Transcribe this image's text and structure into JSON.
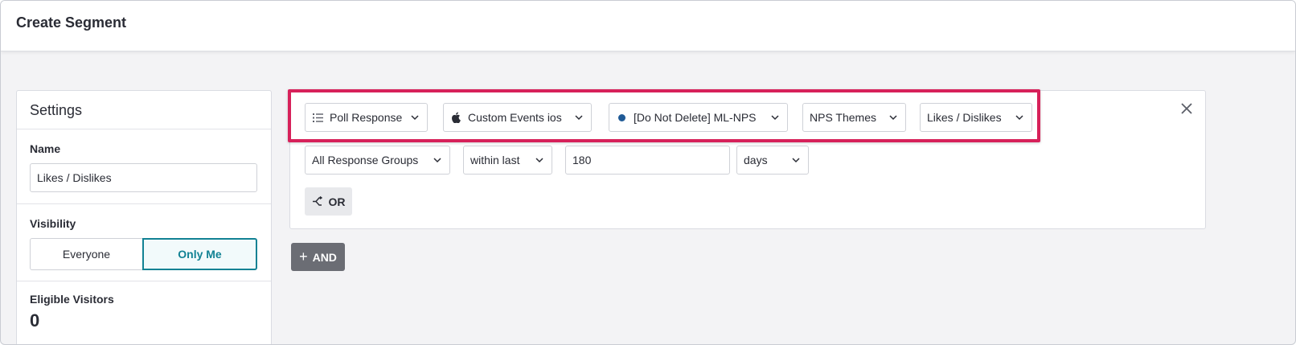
{
  "header": {
    "title": "Create Segment"
  },
  "settings": {
    "title": "Settings",
    "name_label": "Name",
    "name_value": "Likes / Dislikes",
    "visibility_label": "Visibility",
    "visibility_options": [
      "Everyone",
      "Only Me"
    ],
    "visibility_selected": "Only Me",
    "eligible_label": "Eligible Visitors",
    "eligible_count": "0"
  },
  "rule": {
    "filters": [
      {
        "label": "Poll Response",
        "icon": "list-icon"
      },
      {
        "label": "Custom Events ios",
        "icon": "apple-icon"
      },
      {
        "label": "[Do Not Delete] ML-NPS",
        "icon": "status-dot",
        "dot_color": "#1f5a96"
      },
      {
        "label": "NPS Themes"
      },
      {
        "label": "Likes / Dislikes"
      }
    ],
    "response_group": "All Response Groups",
    "time_operator": "within last",
    "time_value": "180",
    "time_unit": "days",
    "or_label": "OR",
    "and_label": "AND"
  },
  "colors": {
    "highlight": "#d7215a",
    "accent": "#128294",
    "and_button": "#6b6d74"
  }
}
